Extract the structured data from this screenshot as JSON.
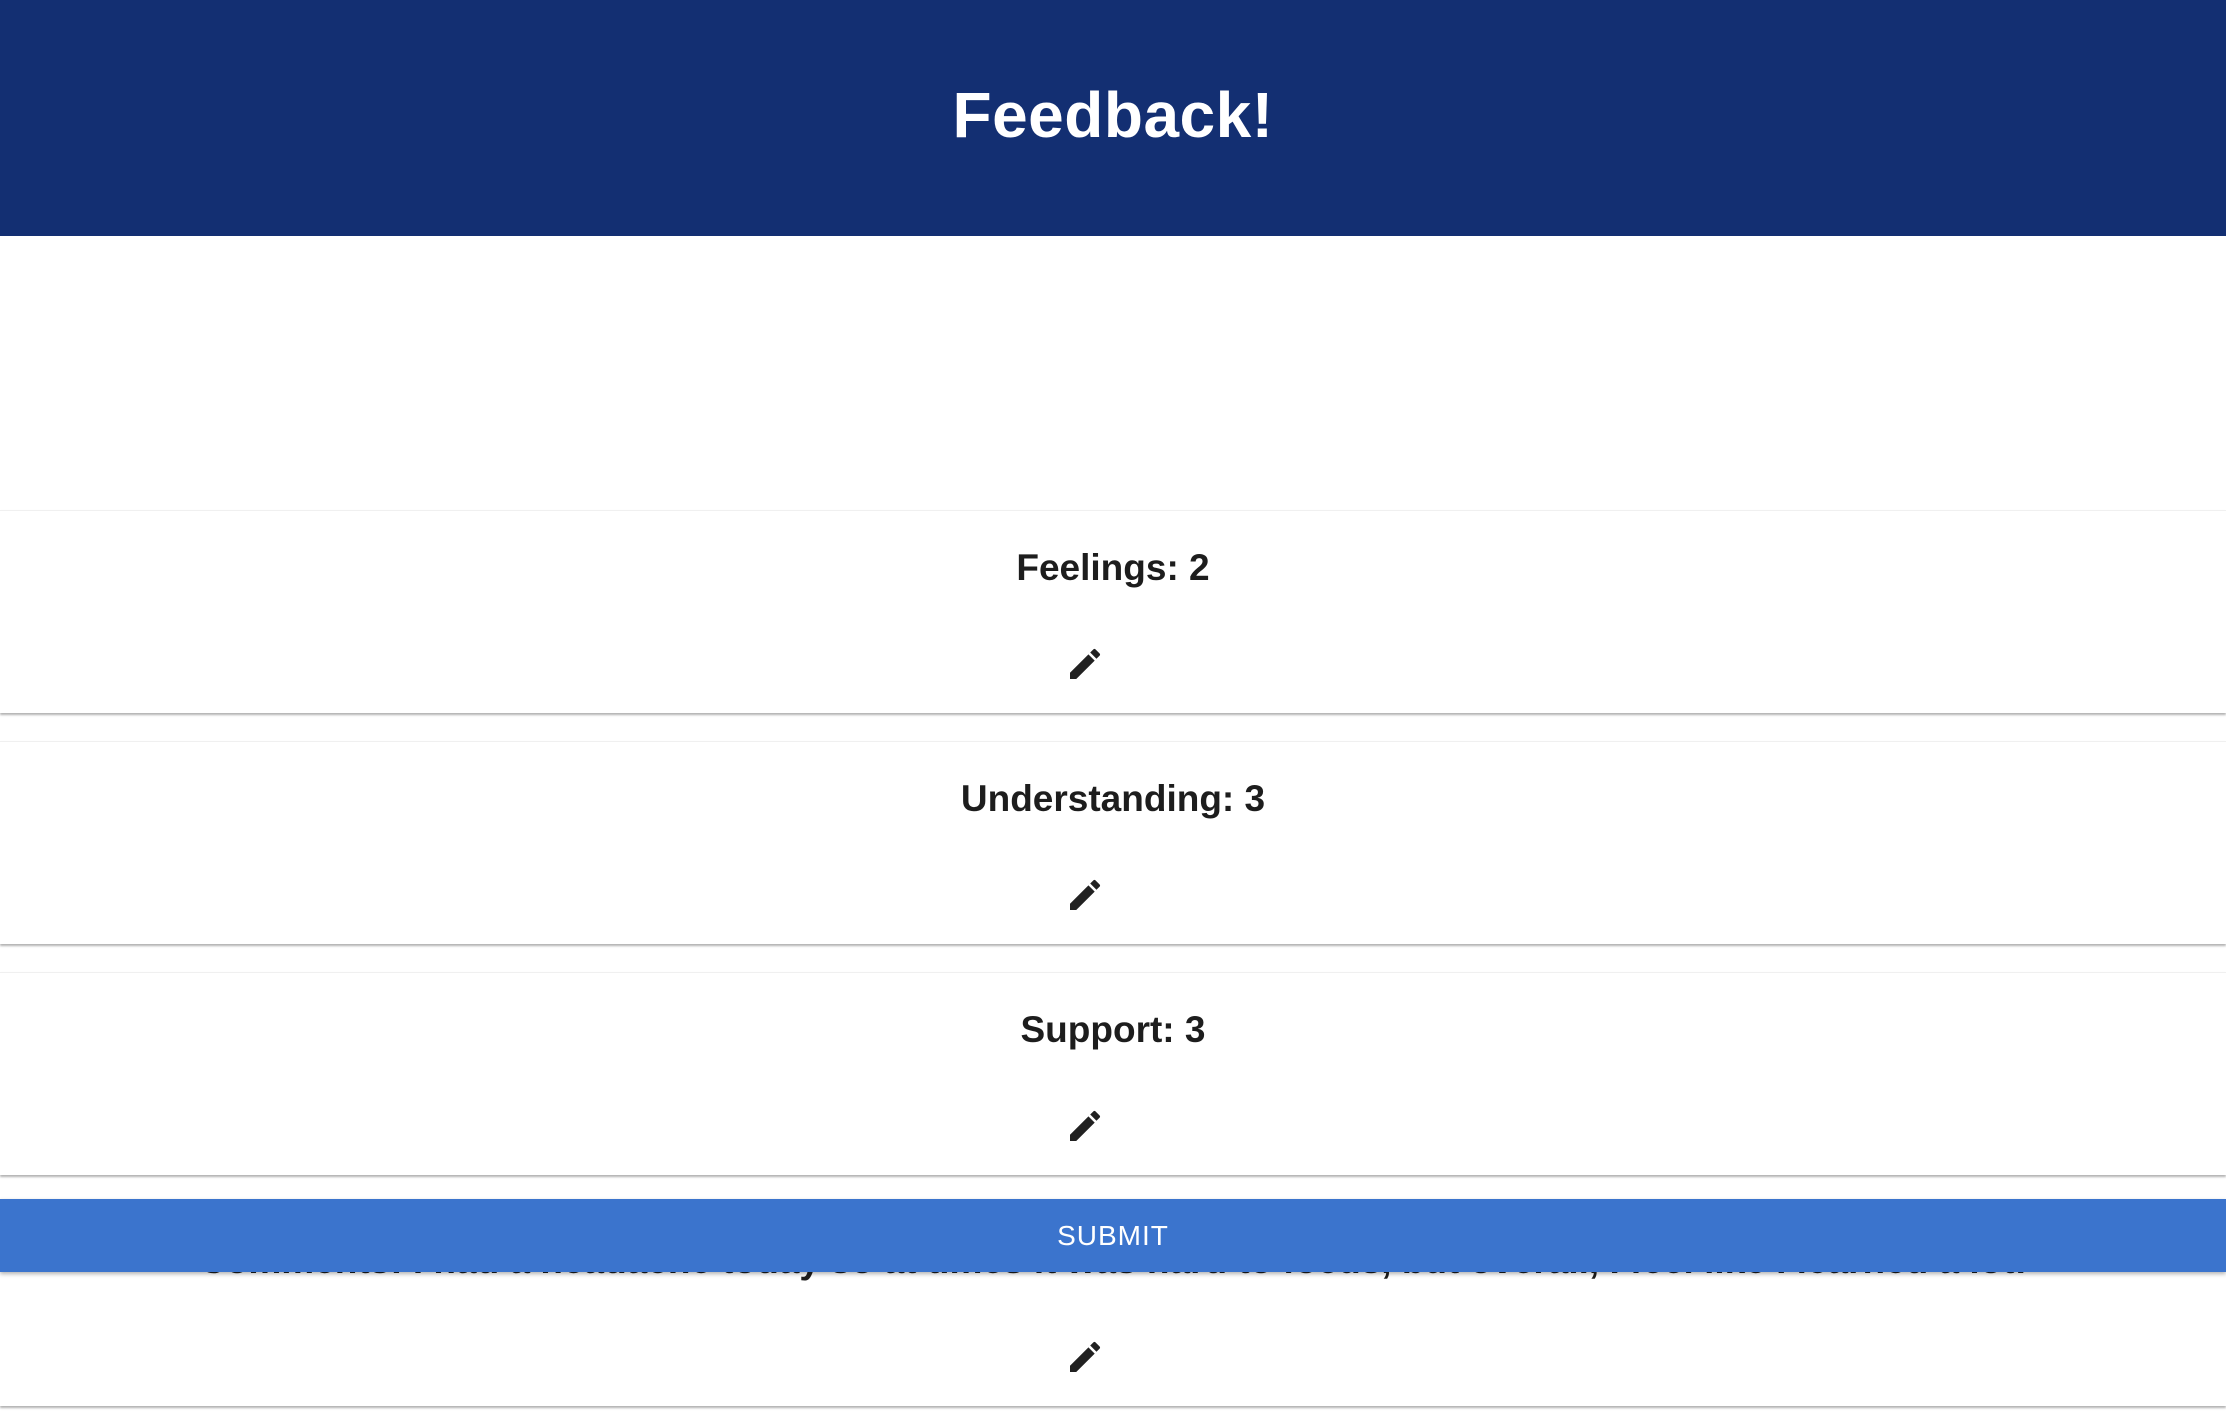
{
  "header": {
    "title": "Feedback!",
    "background": "#132f72"
  },
  "review": {
    "items": [
      {
        "label": "Feelings: 2",
        "edit_icon": "pencil-icon"
      },
      {
        "label": "Understanding: 3",
        "edit_icon": "pencil-icon"
      },
      {
        "label": "Support: 3",
        "edit_icon": "pencil-icon"
      },
      {
        "label": "Comments: I had a headache today so at times it was hard to focus, but overall, I feel like I learned a lot!",
        "edit_icon": "pencil-icon"
      }
    ]
  },
  "actions": {
    "submit_label": "SUBMIT",
    "submit_color": "#3b74cd"
  }
}
